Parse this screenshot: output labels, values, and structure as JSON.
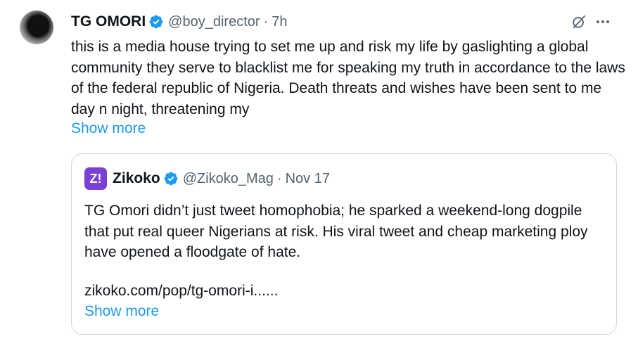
{
  "tweet": {
    "author_name": "TG OMORI",
    "author_handle": "@boy_director",
    "separator": "·",
    "time": "7h",
    "text": "this is a media house trying to set me up and risk my life by gaslighting a global community they serve to blacklist me for speaking my truth in accordance to the laws of the federal republic of Nigeria. Death threats and wishes have been sent to me day n night, threatening my",
    "show_more": "Show more"
  },
  "quote": {
    "logo_text": "Z!",
    "author_name": "Zikoko",
    "author_handle": "@Zikoko_Mag",
    "separator": "·",
    "date": "Nov 17",
    "text": "TG Omori didn’t just tweet homophobia; he sparked a weekend-long dogpile that put real queer Nigerians at risk. His viral tweet and cheap marketing ploy have opened a floodgate of hate.",
    "link": "zikoko.com/pop/tg-omori-i......",
    "show_more": "Show more"
  },
  "icons": {
    "verified": "verified-badge-icon",
    "grok": "grok-icon",
    "more": "more-options-icon"
  },
  "colors": {
    "accent": "#1d9bf0",
    "text": "#0f1419",
    "muted": "#536471",
    "border": "#cfd9de",
    "zikoko": "#7a3fd6"
  }
}
